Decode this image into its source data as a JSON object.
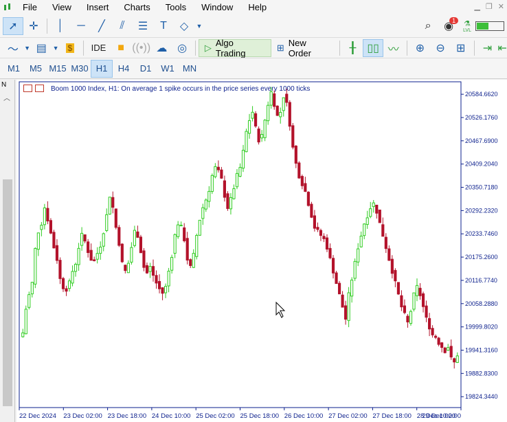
{
  "menu": [
    "File",
    "View",
    "Insert",
    "Charts",
    "Tools",
    "Window",
    "Help"
  ],
  "notifications": {
    "badge": "1",
    "level": "LVL"
  },
  "toolbar2": {
    "ide": "IDE",
    "algo_trading": "Algo Trading",
    "new_order": "New Order"
  },
  "timeframes": [
    "M1",
    "M5",
    "M15",
    "M30",
    "H1",
    "H4",
    "D1",
    "W1",
    "MN"
  ],
  "active_timeframe": "H1",
  "chart": {
    "title": "Boom 1000 Index, H1:  On average 1 spike occurs in the price series every 1000 ticks",
    "up_color": "#2ecc1f",
    "down_color": "#b3122b",
    "axis_color": "#0b1f8c"
  },
  "chart_data": {
    "type": "candlestick",
    "symbol": "Boom 1000 Index",
    "timeframe": "H1",
    "y_ticks": [
      "20584.6620",
      "20526.1760",
      "20467.6900",
      "20409.2040",
      "20350.7180",
      "20292.2320",
      "20233.7460",
      "20175.2600",
      "20116.7740",
      "20058.2880",
      "19999.8020",
      "19941.3160",
      "19882.8300",
      "19824.3440"
    ],
    "x_ticks": [
      "22 Dec 2024",
      "23 Dec 02:00",
      "23 Dec 18:00",
      "24 Dec 10:00",
      "25 Dec 02:00",
      "25 Dec 18:00",
      "26 Dec 10:00",
      "27 Dec 02:00",
      "27 Dec 18:00",
      "28 Dec 10:00",
      "29 Dec 02:00"
    ],
    "ylim": [
      19797,
      20616
    ],
    "close_path": [
      19985,
      20045,
      20080,
      20110,
      20195,
      20240,
      20260,
      20300,
      20270,
      20235,
      20200,
      20170,
      20120,
      20100,
      20095,
      20110,
      20140,
      20160,
      20200,
      20230,
      20215,
      20190,
      20170,
      20165,
      20185,
      20205,
      20240,
      20280,
      20330,
      20300,
      20250,
      20210,
      20160,
      20140,
      20160,
      20200,
      20240,
      20230,
      20190,
      20150,
      20135,
      20150,
      20130,
      20110,
      20095,
      20085,
      20100,
      20140,
      20180,
      20230,
      20260,
      20250,
      20220,
      20170,
      20150,
      20180,
      20230,
      20270,
      20300,
      20320,
      20345,
      20380,
      20400,
      20390,
      20370,
      20330,
      20300,
      20320,
      20350,
      20380,
      20400,
      20440,
      20490,
      20520,
      20540,
      20500,
      20470,
      20480,
      20520,
      20560,
      20590,
      20560,
      20530,
      20540,
      20580,
      20560,
      20510,
      20450,
      20410,
      20380,
      20360,
      20340,
      20310,
      20280,
      20250,
      20240,
      20230,
      20220,
      20200,
      20170,
      20140,
      20110,
      20080,
      20050,
      20020,
      20080,
      20120,
      20160,
      20200,
      20230,
      20260,
      20280,
      20300,
      20310,
      20290,
      20260,
      20230,
      20200,
      20170,
      20140,
      20110,
      20080,
      20050,
      20030,
      20010,
      20040,
      20080,
      20100,
      20080,
      20050,
      20020,
      20000,
      19980,
      19975,
      19960,
      19950,
      19940,
      19950,
      19920,
      19910,
      19930
    ]
  }
}
